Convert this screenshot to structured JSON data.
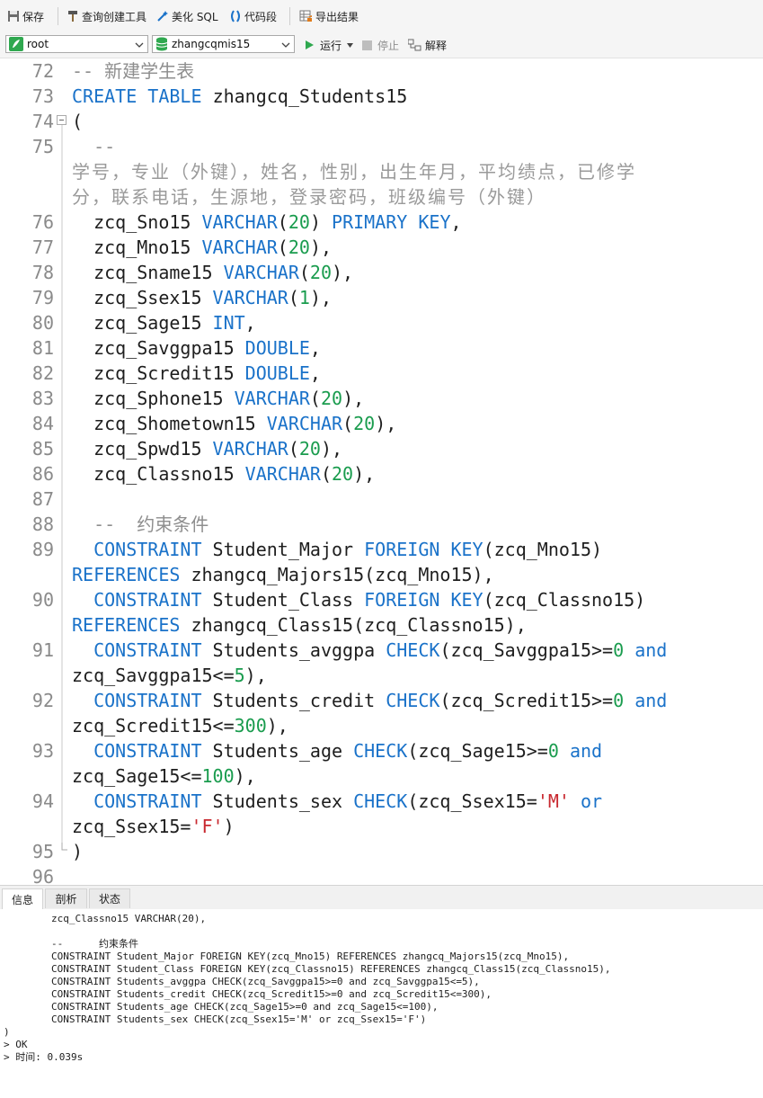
{
  "toolbar": {
    "save": "保存",
    "query_builder": "查询创建工具",
    "beautify_sql": "美化 SQL",
    "snippet": "代码段",
    "export": "导出结果"
  },
  "connection": {
    "name": "root",
    "database": "zhangcqmis15"
  },
  "actions": {
    "run": "运行",
    "stop": "停止",
    "explain": "解释"
  },
  "editor": {
    "line_numbers": [
      "72",
      "73",
      "74",
      "75",
      "76",
      "77",
      "78",
      "79",
      "80",
      "81",
      "82",
      "83",
      "84",
      "85",
      "86",
      "87",
      "88",
      "89",
      "90",
      "91",
      "92",
      "93",
      "94",
      "95",
      "96"
    ],
    "comment_72": "-- 新建学生表",
    "kw_create": "CREATE",
    "kw_table": "TABLE",
    "table_name": "zhangcq_Students15",
    "open_paren": "(",
    "comment_75": "--",
    "comment_75_wrap1": "学号，专业（外键），姓名，性别，出生年月，平均绩点，已修学",
    "comment_75_wrap2": "分，联系电话，生源地，登录密码，班级编号（外键）",
    "comment_88": "--  约束条件",
    "close_paren": ")",
    "varchar": "VARCHAR",
    "primary_key": "PRIMARY KEY",
    "int": "INT",
    "double": "DOUBLE",
    "constraint": "CONSTRAINT",
    "foreign_key": "FOREIGN KEY",
    "references": "REFERENCES",
    "check": "CHECK",
    "and": "and",
    "or": "or"
  },
  "panel": {
    "tabs": [
      "信息",
      "剖析",
      "状态"
    ],
    "output_lines": [
      "        zcq_Classno15 VARCHAR(20),",
      "",
      "        --      约束条件",
      "        CONSTRAINT Student_Major FOREIGN KEY(zcq_Mno15) REFERENCES zhangcq_Majors15(zcq_Mno15),",
      "        CONSTRAINT Student_Class FOREIGN KEY(zcq_Classno15) REFERENCES zhangcq_Class15(zcq_Classno15),",
      "        CONSTRAINT Students_avggpa CHECK(zcq_Savggpa15>=0 and zcq_Savggpa15<=5),",
      "        CONSTRAINT Students_credit CHECK(zcq_Scredit15>=0 and zcq_Scredit15<=300),",
      "        CONSTRAINT Students_age CHECK(zcq_Sage15>=0 and zcq_Sage15<=100),",
      "        CONSTRAINT Students_sex CHECK(zcq_Ssex15='M' or zcq_Ssex15='F')",
      ")",
      "> OK",
      "> 时间: 0.039s"
    ]
  }
}
